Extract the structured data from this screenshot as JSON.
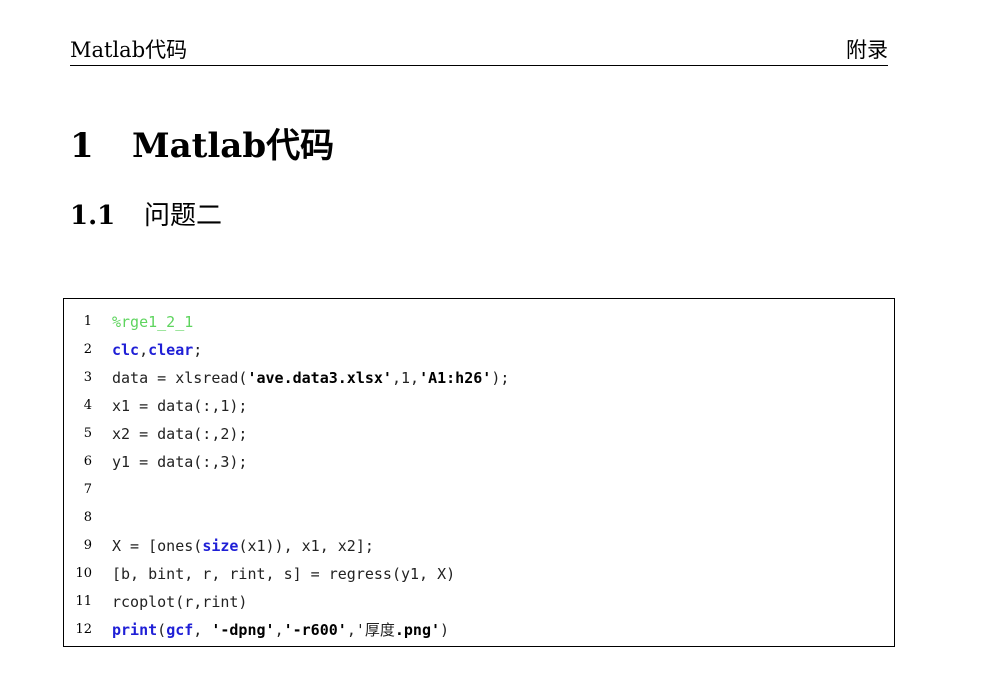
{
  "header": {
    "left": "Matlab代码",
    "right": "附录"
  },
  "section": {
    "number": "1",
    "title": "Matlab代码"
  },
  "subsection": {
    "number": "1.1",
    "title": "问题二"
  },
  "colors": {
    "comment": "#5ed45e",
    "keyword": "#1f1fd6",
    "text": "#222222"
  },
  "code": {
    "lines": [
      {
        "n": "1",
        "tokens": [
          {
            "t": "comment",
            "v": "%rge1_2_1"
          }
        ]
      },
      {
        "n": "2",
        "tokens": [
          {
            "t": "kw",
            "v": "clc"
          },
          {
            "t": "plain",
            "v": ","
          },
          {
            "t": "kw",
            "v": "clear"
          },
          {
            "t": "plain",
            "v": ";"
          }
        ]
      },
      {
        "n": "3",
        "tokens": [
          {
            "t": "plain",
            "v": "data = xlsread("
          },
          {
            "t": "str",
            "v": "'ave.data3.xlsx'"
          },
          {
            "t": "plain",
            "v": ",1,"
          },
          {
            "t": "str",
            "v": "'A1:h26'"
          },
          {
            "t": "plain",
            "v": ");"
          }
        ]
      },
      {
        "n": "4",
        "tokens": [
          {
            "t": "plain",
            "v": "x1 = data(:,1);"
          }
        ]
      },
      {
        "n": "5",
        "tokens": [
          {
            "t": "plain",
            "v": "x2 = data(:,2);"
          }
        ]
      },
      {
        "n": "6",
        "tokens": [
          {
            "t": "plain",
            "v": "y1 = data(:,3);"
          }
        ]
      },
      {
        "n": "7",
        "tokens": []
      },
      {
        "n": "8",
        "tokens": []
      },
      {
        "n": "9",
        "tokens": [
          {
            "t": "plain",
            "v": "X = [ones("
          },
          {
            "t": "kw",
            "v": "size"
          },
          {
            "t": "plain",
            "v": "(x1)), x1, x2];"
          }
        ]
      },
      {
        "n": "10",
        "tokens": [
          {
            "t": "plain",
            "v": "[b, bint, r, rint, s] = regress(y1, X)"
          }
        ]
      },
      {
        "n": "11",
        "tokens": [
          {
            "t": "plain",
            "v": "rcoplot(r,rint)"
          }
        ]
      },
      {
        "n": "12",
        "tokens": [
          {
            "t": "kw",
            "v": "print"
          },
          {
            "t": "plain",
            "v": "("
          },
          {
            "t": "kw",
            "v": "gcf"
          },
          {
            "t": "plain",
            "v": ", "
          },
          {
            "t": "str",
            "v": "'-dpng'"
          },
          {
            "t": "plain",
            "v": ","
          },
          {
            "t": "str",
            "v": "'-r600'"
          },
          {
            "t": "plain",
            "v": ",'厚度"
          },
          {
            "t": "str",
            "v": ".png'"
          },
          {
            "t": "plain",
            "v": ")"
          }
        ]
      }
    ]
  }
}
